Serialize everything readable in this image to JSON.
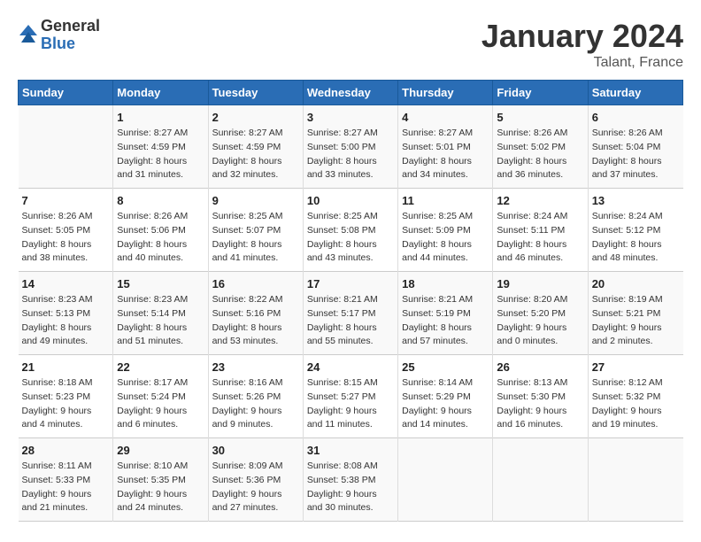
{
  "logo": {
    "general": "General",
    "blue": "Blue"
  },
  "title": "January 2024",
  "location": "Talant, France",
  "days_of_week": [
    "Sunday",
    "Monday",
    "Tuesday",
    "Wednesday",
    "Thursday",
    "Friday",
    "Saturday"
  ],
  "weeks": [
    [
      {
        "day": "",
        "sunrise": "",
        "sunset": "",
        "daylight": ""
      },
      {
        "day": "1",
        "sunrise": "Sunrise: 8:27 AM",
        "sunset": "Sunset: 4:59 PM",
        "daylight": "Daylight: 8 hours and 31 minutes."
      },
      {
        "day": "2",
        "sunrise": "Sunrise: 8:27 AM",
        "sunset": "Sunset: 4:59 PM",
        "daylight": "Daylight: 8 hours and 32 minutes."
      },
      {
        "day": "3",
        "sunrise": "Sunrise: 8:27 AM",
        "sunset": "Sunset: 5:00 PM",
        "daylight": "Daylight: 8 hours and 33 minutes."
      },
      {
        "day": "4",
        "sunrise": "Sunrise: 8:27 AM",
        "sunset": "Sunset: 5:01 PM",
        "daylight": "Daylight: 8 hours and 34 minutes."
      },
      {
        "day": "5",
        "sunrise": "Sunrise: 8:26 AM",
        "sunset": "Sunset: 5:02 PM",
        "daylight": "Daylight: 8 hours and 36 minutes."
      },
      {
        "day": "6",
        "sunrise": "Sunrise: 8:26 AM",
        "sunset": "Sunset: 5:04 PM",
        "daylight": "Daylight: 8 hours and 37 minutes."
      }
    ],
    [
      {
        "day": "7",
        "sunrise": "Sunrise: 8:26 AM",
        "sunset": "Sunset: 5:05 PM",
        "daylight": "Daylight: 8 hours and 38 minutes."
      },
      {
        "day": "8",
        "sunrise": "Sunrise: 8:26 AM",
        "sunset": "Sunset: 5:06 PM",
        "daylight": "Daylight: 8 hours and 40 minutes."
      },
      {
        "day": "9",
        "sunrise": "Sunrise: 8:25 AM",
        "sunset": "Sunset: 5:07 PM",
        "daylight": "Daylight: 8 hours and 41 minutes."
      },
      {
        "day": "10",
        "sunrise": "Sunrise: 8:25 AM",
        "sunset": "Sunset: 5:08 PM",
        "daylight": "Daylight: 8 hours and 43 minutes."
      },
      {
        "day": "11",
        "sunrise": "Sunrise: 8:25 AM",
        "sunset": "Sunset: 5:09 PM",
        "daylight": "Daylight: 8 hours and 44 minutes."
      },
      {
        "day": "12",
        "sunrise": "Sunrise: 8:24 AM",
        "sunset": "Sunset: 5:11 PM",
        "daylight": "Daylight: 8 hours and 46 minutes."
      },
      {
        "day": "13",
        "sunrise": "Sunrise: 8:24 AM",
        "sunset": "Sunset: 5:12 PM",
        "daylight": "Daylight: 8 hours and 48 minutes."
      }
    ],
    [
      {
        "day": "14",
        "sunrise": "Sunrise: 8:23 AM",
        "sunset": "Sunset: 5:13 PM",
        "daylight": "Daylight: 8 hours and 49 minutes."
      },
      {
        "day": "15",
        "sunrise": "Sunrise: 8:23 AM",
        "sunset": "Sunset: 5:14 PM",
        "daylight": "Daylight: 8 hours and 51 minutes."
      },
      {
        "day": "16",
        "sunrise": "Sunrise: 8:22 AM",
        "sunset": "Sunset: 5:16 PM",
        "daylight": "Daylight: 8 hours and 53 minutes."
      },
      {
        "day": "17",
        "sunrise": "Sunrise: 8:21 AM",
        "sunset": "Sunset: 5:17 PM",
        "daylight": "Daylight: 8 hours and 55 minutes."
      },
      {
        "day": "18",
        "sunrise": "Sunrise: 8:21 AM",
        "sunset": "Sunset: 5:19 PM",
        "daylight": "Daylight: 8 hours and 57 minutes."
      },
      {
        "day": "19",
        "sunrise": "Sunrise: 8:20 AM",
        "sunset": "Sunset: 5:20 PM",
        "daylight": "Daylight: 9 hours and 0 minutes."
      },
      {
        "day": "20",
        "sunrise": "Sunrise: 8:19 AM",
        "sunset": "Sunset: 5:21 PM",
        "daylight": "Daylight: 9 hours and 2 minutes."
      }
    ],
    [
      {
        "day": "21",
        "sunrise": "Sunrise: 8:18 AM",
        "sunset": "Sunset: 5:23 PM",
        "daylight": "Daylight: 9 hours and 4 minutes."
      },
      {
        "day": "22",
        "sunrise": "Sunrise: 8:17 AM",
        "sunset": "Sunset: 5:24 PM",
        "daylight": "Daylight: 9 hours and 6 minutes."
      },
      {
        "day": "23",
        "sunrise": "Sunrise: 8:16 AM",
        "sunset": "Sunset: 5:26 PM",
        "daylight": "Daylight: 9 hours and 9 minutes."
      },
      {
        "day": "24",
        "sunrise": "Sunrise: 8:15 AM",
        "sunset": "Sunset: 5:27 PM",
        "daylight": "Daylight: 9 hours and 11 minutes."
      },
      {
        "day": "25",
        "sunrise": "Sunrise: 8:14 AM",
        "sunset": "Sunset: 5:29 PM",
        "daylight": "Daylight: 9 hours and 14 minutes."
      },
      {
        "day": "26",
        "sunrise": "Sunrise: 8:13 AM",
        "sunset": "Sunset: 5:30 PM",
        "daylight": "Daylight: 9 hours and 16 minutes."
      },
      {
        "day": "27",
        "sunrise": "Sunrise: 8:12 AM",
        "sunset": "Sunset: 5:32 PM",
        "daylight": "Daylight: 9 hours and 19 minutes."
      }
    ],
    [
      {
        "day": "28",
        "sunrise": "Sunrise: 8:11 AM",
        "sunset": "Sunset: 5:33 PM",
        "daylight": "Daylight: 9 hours and 21 minutes."
      },
      {
        "day": "29",
        "sunrise": "Sunrise: 8:10 AM",
        "sunset": "Sunset: 5:35 PM",
        "daylight": "Daylight: 9 hours and 24 minutes."
      },
      {
        "day": "30",
        "sunrise": "Sunrise: 8:09 AM",
        "sunset": "Sunset: 5:36 PM",
        "daylight": "Daylight: 9 hours and 27 minutes."
      },
      {
        "day": "31",
        "sunrise": "Sunrise: 8:08 AM",
        "sunset": "Sunset: 5:38 PM",
        "daylight": "Daylight: 9 hours and 30 minutes."
      },
      {
        "day": "",
        "sunrise": "",
        "sunset": "",
        "daylight": ""
      },
      {
        "day": "",
        "sunrise": "",
        "sunset": "",
        "daylight": ""
      },
      {
        "day": "",
        "sunrise": "",
        "sunset": "",
        "daylight": ""
      }
    ]
  ]
}
